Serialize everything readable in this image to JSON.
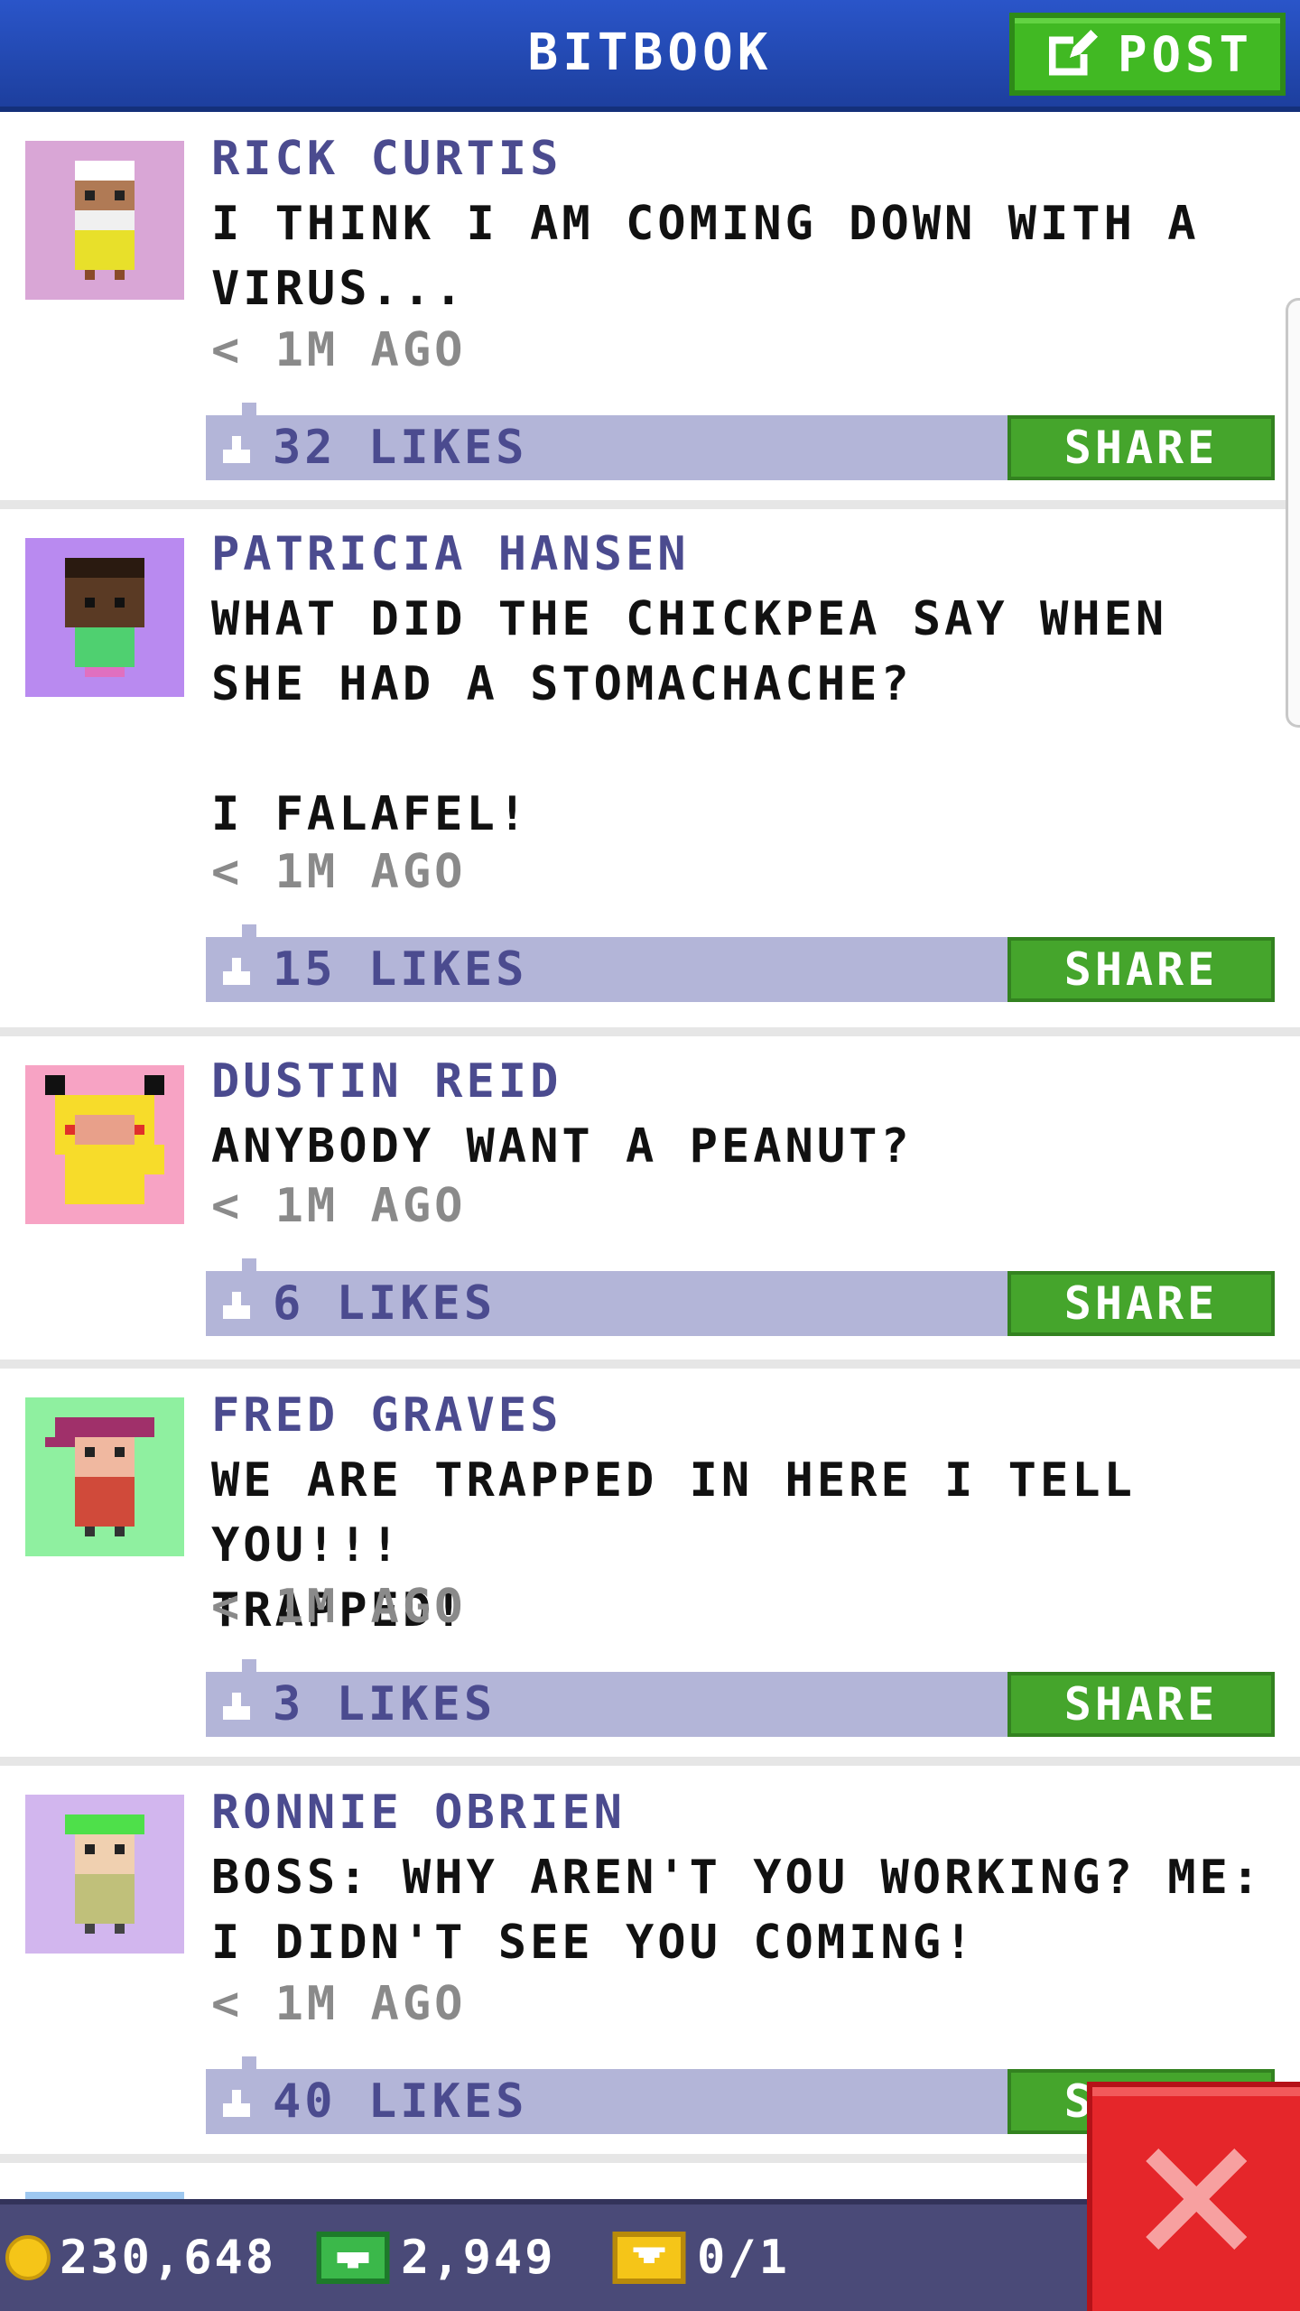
{
  "header": {
    "title": "BITBOOK",
    "post_label": "POST"
  },
  "share_label": "SHARE",
  "posts": [
    {
      "author": "RICK CURTIS",
      "body": "I THINK I AM COMING DOWN WITH A\nVIRUS...",
      "time": "< 1M AGO",
      "likes": "32 LIKES",
      "avatar_bg": "#d9a6d6"
    },
    {
      "author": "PATRICIA HANSEN",
      "body": "WHAT DID THE CHICKPEA SAY WHEN\nSHE HAD A STOMACHACHE?\n\nI FALAFEL!",
      "time": "< 1M AGO",
      "likes": "15 LIKES",
      "avatar_bg": "#b98af0"
    },
    {
      "author": "DUSTIN REID",
      "body": "ANYBODY WANT A PEANUT?",
      "time": "< 1M AGO",
      "likes": "6 LIKES",
      "avatar_bg": "#f7a3c4"
    },
    {
      "author": "FRED GRAVES",
      "body": "WE ARE TRAPPED IN HERE I TELL YOU!!!\nTRAPPED!",
      "time": "< 1M AGO",
      "likes": "3 LIKES",
      "avatar_bg": "#8ff0a0"
    },
    {
      "author": "RONNIE OBRIEN",
      "body": "BOSS: WHY AREN'T YOU WORKING? ME:\nI DIDN'T SEE YOU COMING!",
      "time": "< 1M AGO",
      "likes": "40 LIKES",
      "avatar_bg": "#d2b6ee"
    }
  ],
  "bottom_bar": {
    "coins": "230,648",
    "bux": "2,949",
    "tickets": "0/1"
  },
  "colors": {
    "header": "#2a55c9",
    "post_button": "#41b923",
    "share_button": "#45a52c",
    "likes_bar": "#b3b5d8",
    "close_button": "#e5262a"
  }
}
